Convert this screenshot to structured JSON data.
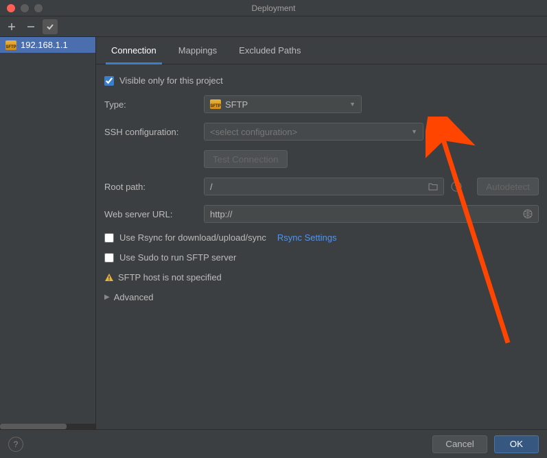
{
  "window": {
    "title": "Deployment"
  },
  "sidebar": {
    "items": [
      {
        "label": "192.168.1.1"
      }
    ]
  },
  "tabs": [
    {
      "label": "Connection",
      "active": true
    },
    {
      "label": "Mappings",
      "active": false
    },
    {
      "label": "Excluded Paths",
      "active": false
    }
  ],
  "form": {
    "visible_only_label": "Visible only for this project",
    "visible_only_checked": true,
    "type_label": "Type:",
    "type_value": "SFTP",
    "ssh_label": "SSH configuration:",
    "ssh_placeholder": "<select configuration>",
    "test_connection_label": "Test Connection",
    "root_path_label": "Root path:",
    "root_path_value": "/",
    "autodetect_label": "Autodetect",
    "web_url_label": "Web server URL:",
    "web_url_value": "http://",
    "rsync_label": "Use Rsync for download/upload/sync",
    "rsync_settings_label": "Rsync Settings",
    "sudo_label": "Use Sudo to run SFTP server",
    "warning_text": "SFTP host is not specified",
    "advanced_label": "Advanced"
  },
  "footer": {
    "cancel_label": "Cancel",
    "ok_label": "OK"
  }
}
